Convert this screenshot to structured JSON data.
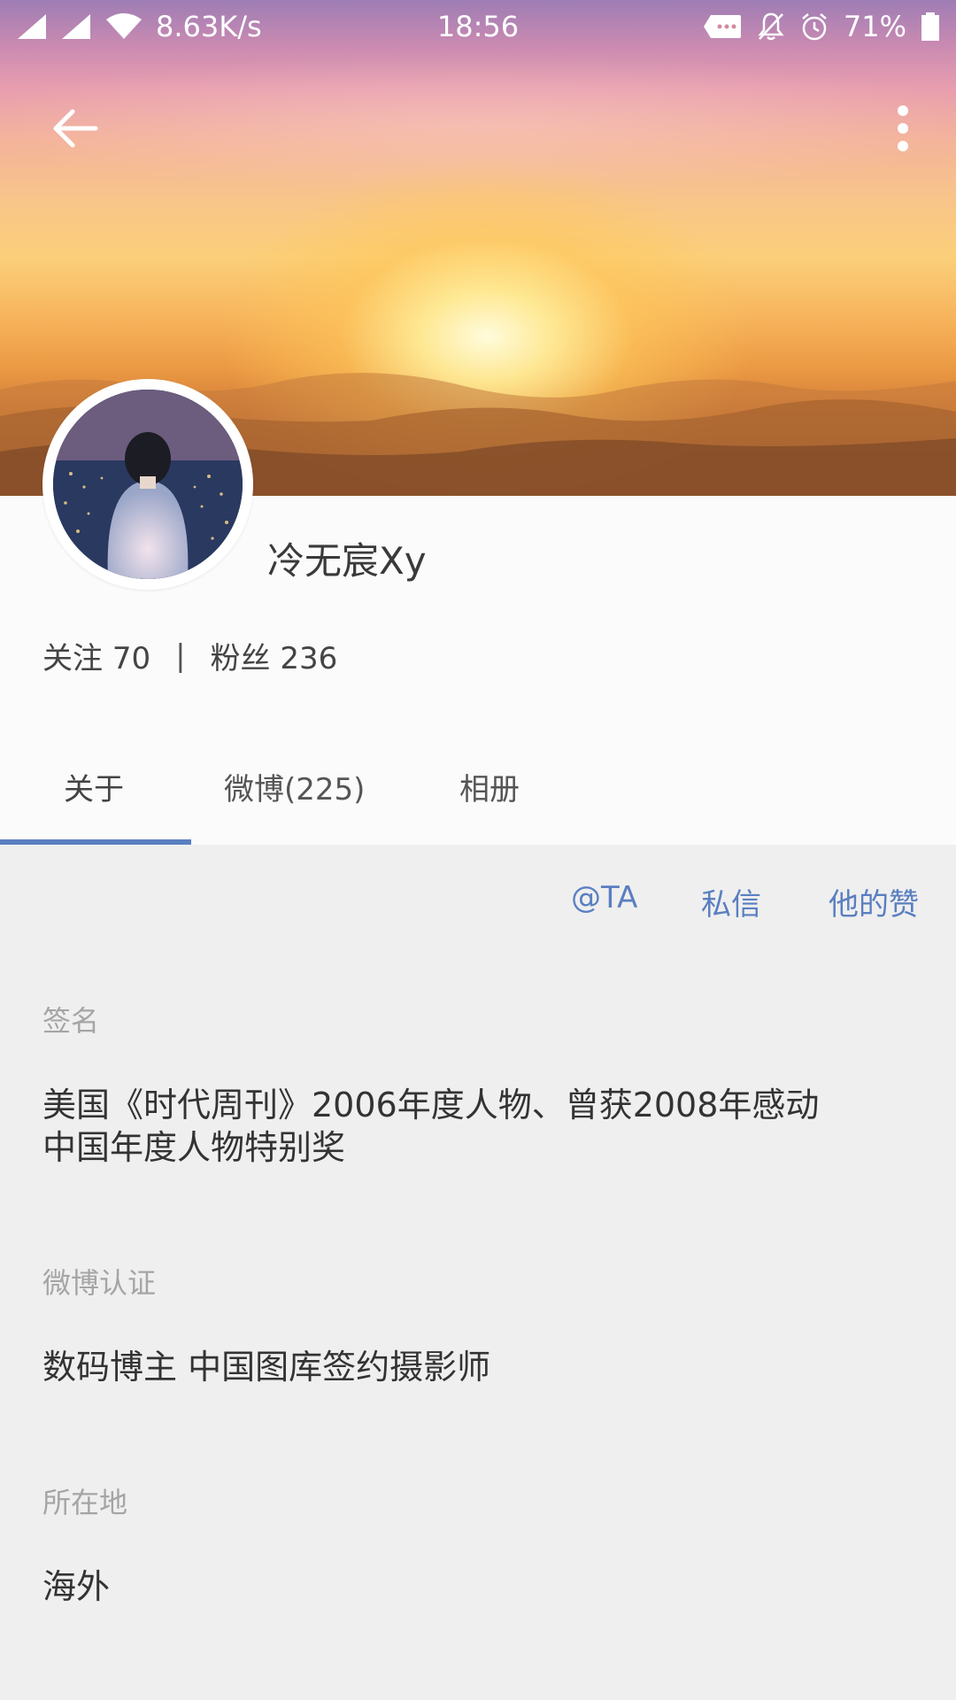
{
  "status_bar": {
    "speed": "8.63K/s",
    "time": "18:56",
    "battery": "71%"
  },
  "profile": {
    "username": "冷无宸Xy",
    "following_label": "关注",
    "following_count": "70",
    "separator": "|",
    "followers_label": "粉丝",
    "followers_count": "236"
  },
  "tabs": [
    {
      "label": "关于"
    },
    {
      "label": "微博(225)"
    },
    {
      "label": "相册"
    }
  ],
  "actions": [
    {
      "label": "@TA"
    },
    {
      "label": "私信"
    },
    {
      "label": "他的赞"
    }
  ],
  "info": {
    "signature_label": "签名",
    "signature_line1": "美国《时代周刊》2006年度人物、曾获2008年感动",
    "signature_line2": "中国年度人物特别奖",
    "verification_label": "微博认证",
    "verification_value": "数码博主 中国图库签约摄影师",
    "location_label": "所在地",
    "location_value": "海外"
  },
  "colors": {
    "accent": "#5a7fc1",
    "label_gray": "#a5a5a5",
    "background": "#efefef"
  },
  "icons": [
    "signal-icon",
    "wifi-icon",
    "message-icon",
    "mute-icon",
    "alarm-icon",
    "battery-icon",
    "back-arrow-icon",
    "more-vert-icon"
  ]
}
